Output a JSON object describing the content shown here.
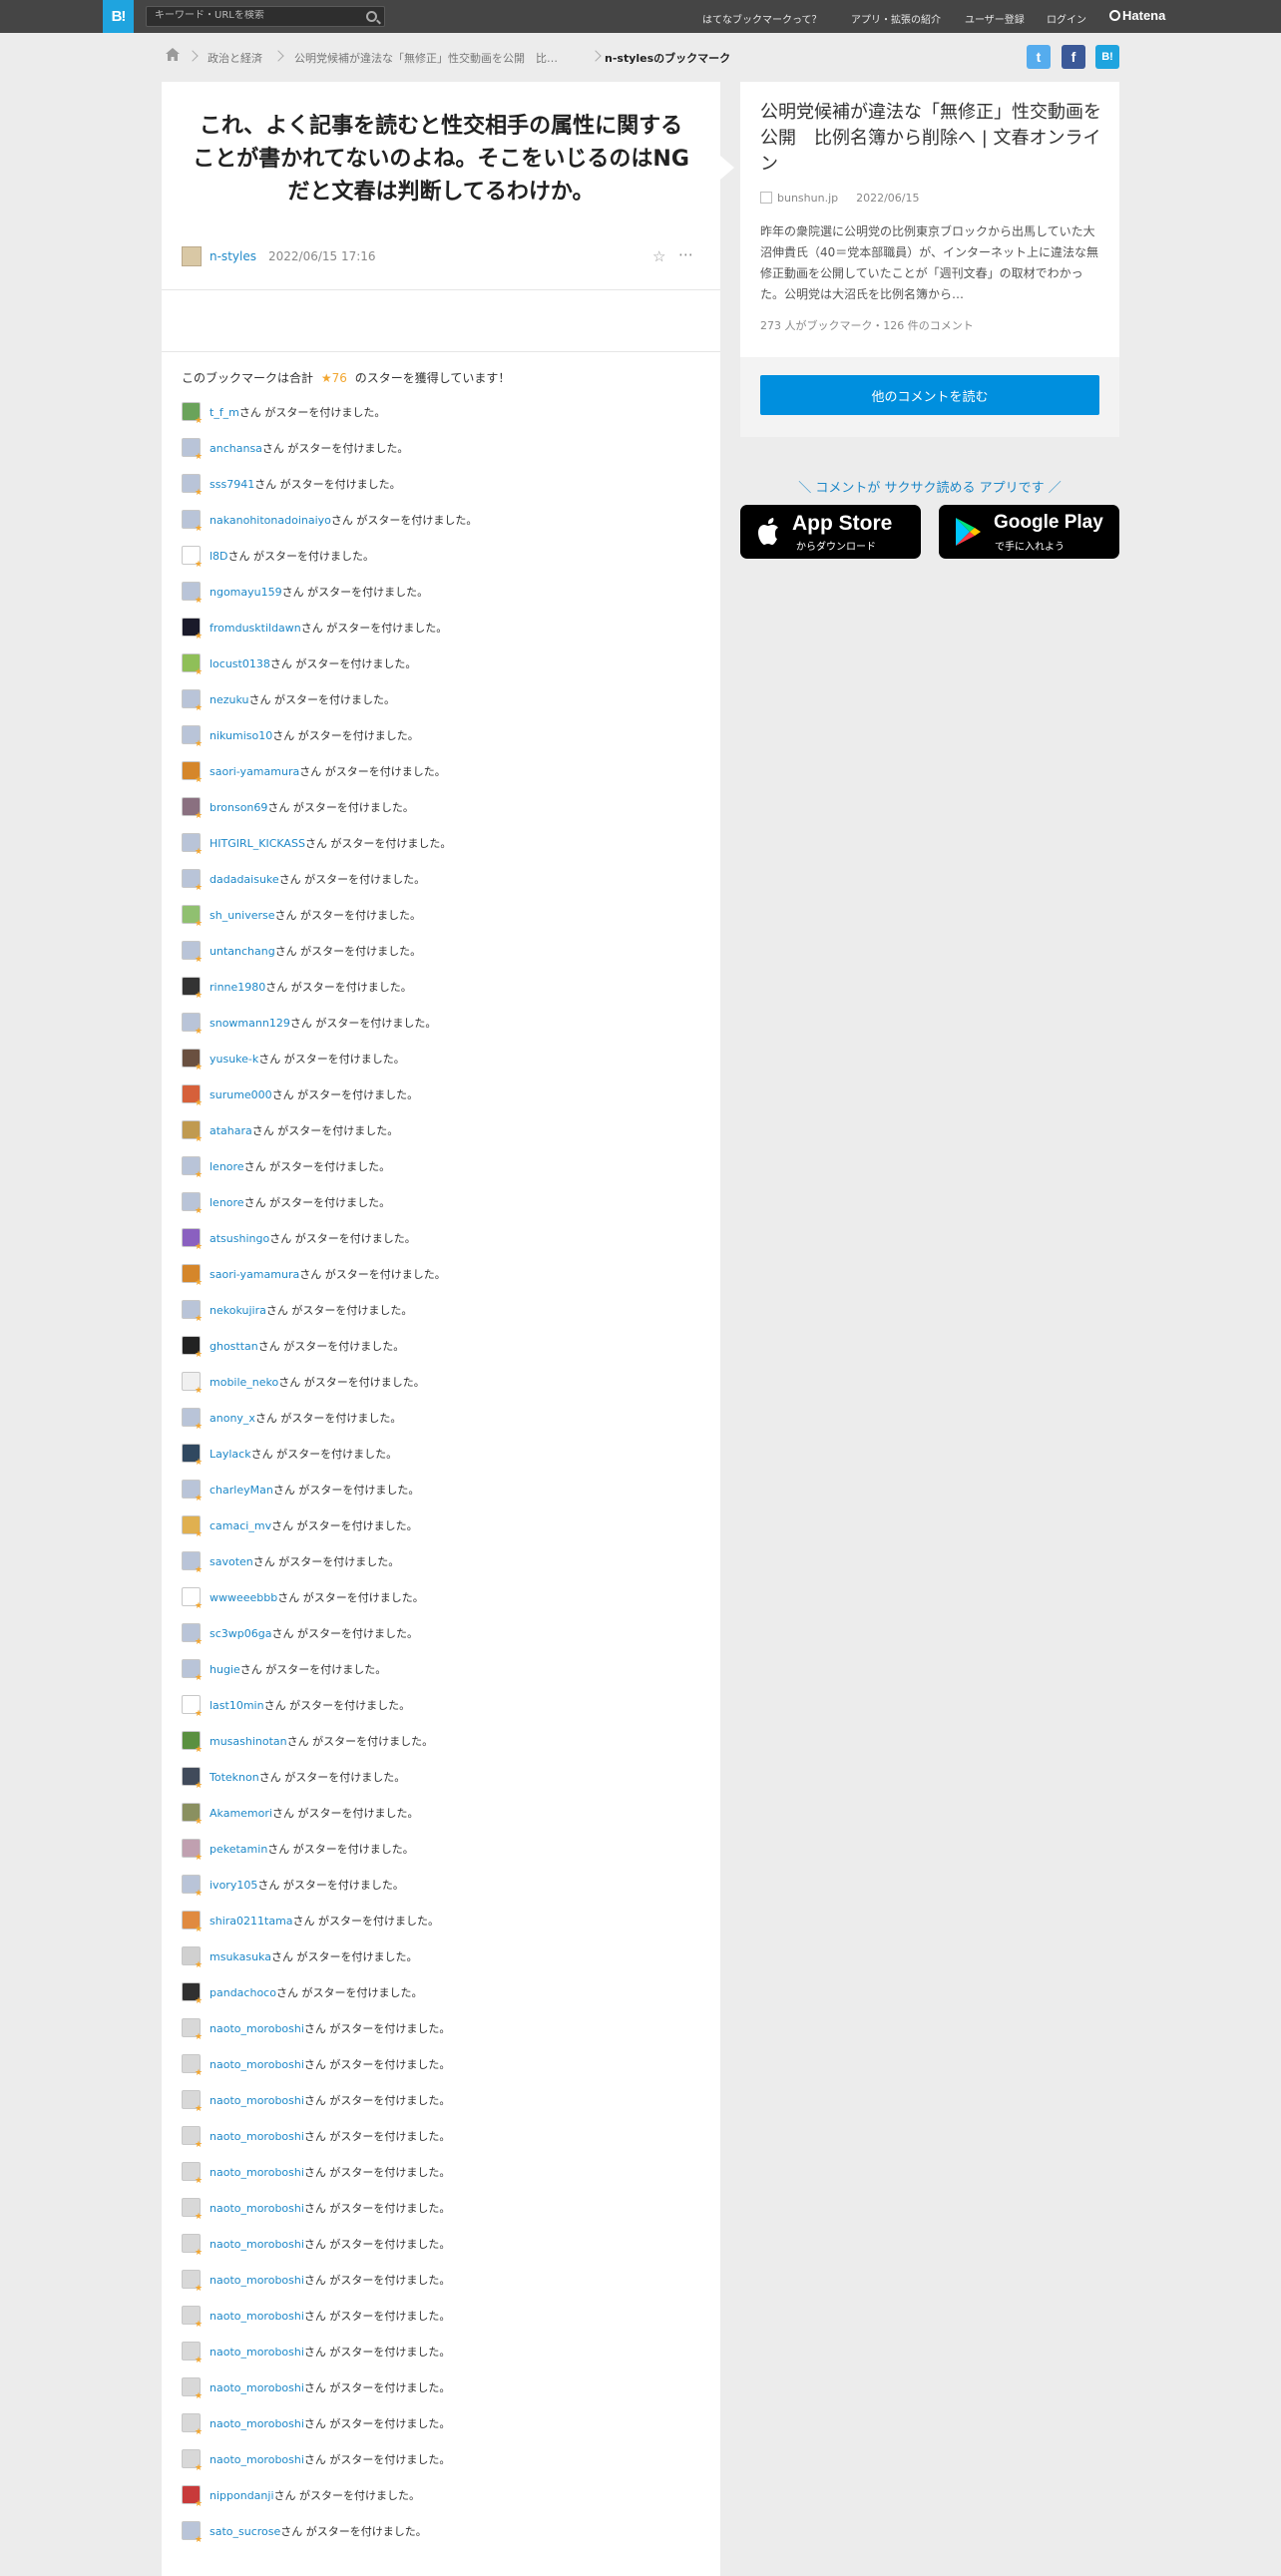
{
  "header": {
    "logo": "B!",
    "search_placeholder": "キーワード・URLを検索",
    "nav": [
      "はてなブックマークって？",
      "アプリ・拡張の紹介",
      "ユーザー登録",
      "ログイン"
    ],
    "brand": "Hatena"
  },
  "breadcrumb": [
    "政治と経済",
    "公明党候補が違法な「無修正」性交動画を公開　比…",
    "n-stylesのブックマーク"
  ],
  "share": {
    "twitter": "t",
    "facebook": "f",
    "hatena": "B!"
  },
  "bookmark": {
    "comment": "これ、よく記事を読むと性交相手の属性に関することが書かれてないのよね。そこをいじるのはNGだと文春は判断してるわけか。",
    "user": "n-styles",
    "date": "2022/06/15 17:16"
  },
  "stars": {
    "summary_pre": "このブックマークは合計",
    "count": "★76",
    "summary_post": "のスターを獲得しています！",
    "suffix": "さん がスターを付けました。",
    "users": [
      {
        "name": "t_f_m",
        "color": "#6aa35a"
      },
      {
        "name": "anchansa",
        "color": "#b9c4d8"
      },
      {
        "name": "sss7941",
        "color": "#b9c4d8"
      },
      {
        "name": "nakanohitonadoinaiyo",
        "color": "#b9c4d8"
      },
      {
        "name": "l8D",
        "color": "#ffffff"
      },
      {
        "name": "ngomayu159",
        "color": "#b9c4d8"
      },
      {
        "name": "fromdusktildawn",
        "color": "#1a1a2a"
      },
      {
        "name": "locust0138",
        "color": "#8fbf58"
      },
      {
        "name": "nezuku",
        "color": "#b9c4d8"
      },
      {
        "name": "nikumiso10",
        "color": "#b9c4d8"
      },
      {
        "name": "saori-yamamura",
        "color": "#d5862a"
      },
      {
        "name": "bronson69",
        "color": "#8a7080"
      },
      {
        "name": "HITGIRL_KICKASS",
        "color": "#b9c4d8"
      },
      {
        "name": "dadadaisuke",
        "color": "#b9c4d8"
      },
      {
        "name": "sh_universe",
        "color": "#90c070"
      },
      {
        "name": "untanchang",
        "color": "#b9c4d8"
      },
      {
        "name": "rinne1980",
        "color": "#333333"
      },
      {
        "name": "snowmann129",
        "color": "#b9c4d8"
      },
      {
        "name": "yusuke-k",
        "color": "#6a5040"
      },
      {
        "name": "surume000",
        "color": "#d6603a"
      },
      {
        "name": "atahara",
        "color": "#c09a50"
      },
      {
        "name": "lenore",
        "color": "#b9c4d8"
      },
      {
        "name": "lenore",
        "color": "#b9c4d8"
      },
      {
        "name": "atsushingo",
        "color": "#8a60c0"
      },
      {
        "name": "saori-yamamura",
        "color": "#d5862a"
      },
      {
        "name": "nekokujira",
        "color": "#b9c4d8"
      },
      {
        "name": "ghosttan",
        "color": "#222222"
      },
      {
        "name": "mobile_neko",
        "color": "#f0f0f0"
      },
      {
        "name": "anony_x",
        "color": "#b9c4d8"
      },
      {
        "name": "Laylack",
        "color": "#304860"
      },
      {
        "name": "charleyMan",
        "color": "#b9c4d8"
      },
      {
        "name": "camaci_mv",
        "color": "#e0b050"
      },
      {
        "name": "savoten",
        "color": "#b9c4d8"
      },
      {
        "name": "wwweeebbb",
        "color": "#ffffff"
      },
      {
        "name": "sc3wp06ga",
        "color": "#b9c4d8"
      },
      {
        "name": "hugie",
        "color": "#b9c4d8"
      },
      {
        "name": "last10min",
        "color": "#ffffff"
      },
      {
        "name": "musashinotan",
        "color": "#5a9040"
      },
      {
        "name": "Toteknon",
        "color": "#404a5a"
      },
      {
        "name": "Akamemori",
        "color": "#8a9060"
      },
      {
        "name": "peketamin",
        "color": "#c0a0b0"
      },
      {
        "name": "ivory105",
        "color": "#b9c4d8"
      },
      {
        "name": "shira0211tama",
        "color": "#e08a40"
      },
      {
        "name": "msukasuka",
        "color": "#d0d0d0"
      },
      {
        "name": "pandachoco",
        "color": "#303030"
      },
      {
        "name": "naoto_moroboshi",
        "color": "#d8d8d8"
      },
      {
        "name": "naoto_moroboshi",
        "color": "#d8d8d8"
      },
      {
        "name": "naoto_moroboshi",
        "color": "#d8d8d8"
      },
      {
        "name": "naoto_moroboshi",
        "color": "#d8d8d8"
      },
      {
        "name": "naoto_moroboshi",
        "color": "#d8d8d8"
      },
      {
        "name": "naoto_moroboshi",
        "color": "#d8d8d8"
      },
      {
        "name": "naoto_moroboshi",
        "color": "#d8d8d8"
      },
      {
        "name": "naoto_moroboshi",
        "color": "#d8d8d8"
      },
      {
        "name": "naoto_moroboshi",
        "color": "#d8d8d8"
      },
      {
        "name": "naoto_moroboshi",
        "color": "#d8d8d8"
      },
      {
        "name": "naoto_moroboshi",
        "color": "#d8d8d8"
      },
      {
        "name": "naoto_moroboshi",
        "color": "#d8d8d8"
      },
      {
        "name": "naoto_moroboshi",
        "color": "#d8d8d8"
      },
      {
        "name": "nippondanji",
        "color": "#c83a3a"
      },
      {
        "name": "sato_sucrose",
        "color": "#b9c4d8"
      }
    ]
  },
  "entry": {
    "title": "公明党候補が違法な「無修正」性交動画を公開　比例名簿から削除へ | 文春オンライン",
    "source": "bunshun.jp",
    "date": "2022/06/15",
    "summary": "昨年の衆院選に公明党の比例東京ブロックから出馬していた大沼伸貴氏（40＝党本部職員）が、インターネット上に違法な無修正動画を公開していたことが「週刊文春」の取材でわかった。公明党は大沼氏を比例名簿から…",
    "meta": "273 人がブックマーク・126 件のコメント",
    "more_button": "他のコメントを読む"
  },
  "app": {
    "promo": "＼ コメントが サクサク読める アプリです ／",
    "appstore_big": "App Store",
    "appstore_small": "からダウンロード",
    "googleplay_big": "Google Play",
    "googleplay_small": "で手に入れよう"
  },
  "colors": {
    "accent": "#1fa4df",
    "link": "#1e88c8",
    "star": "#f2a732",
    "header_bg": "#454545",
    "button": "#008fde"
  }
}
